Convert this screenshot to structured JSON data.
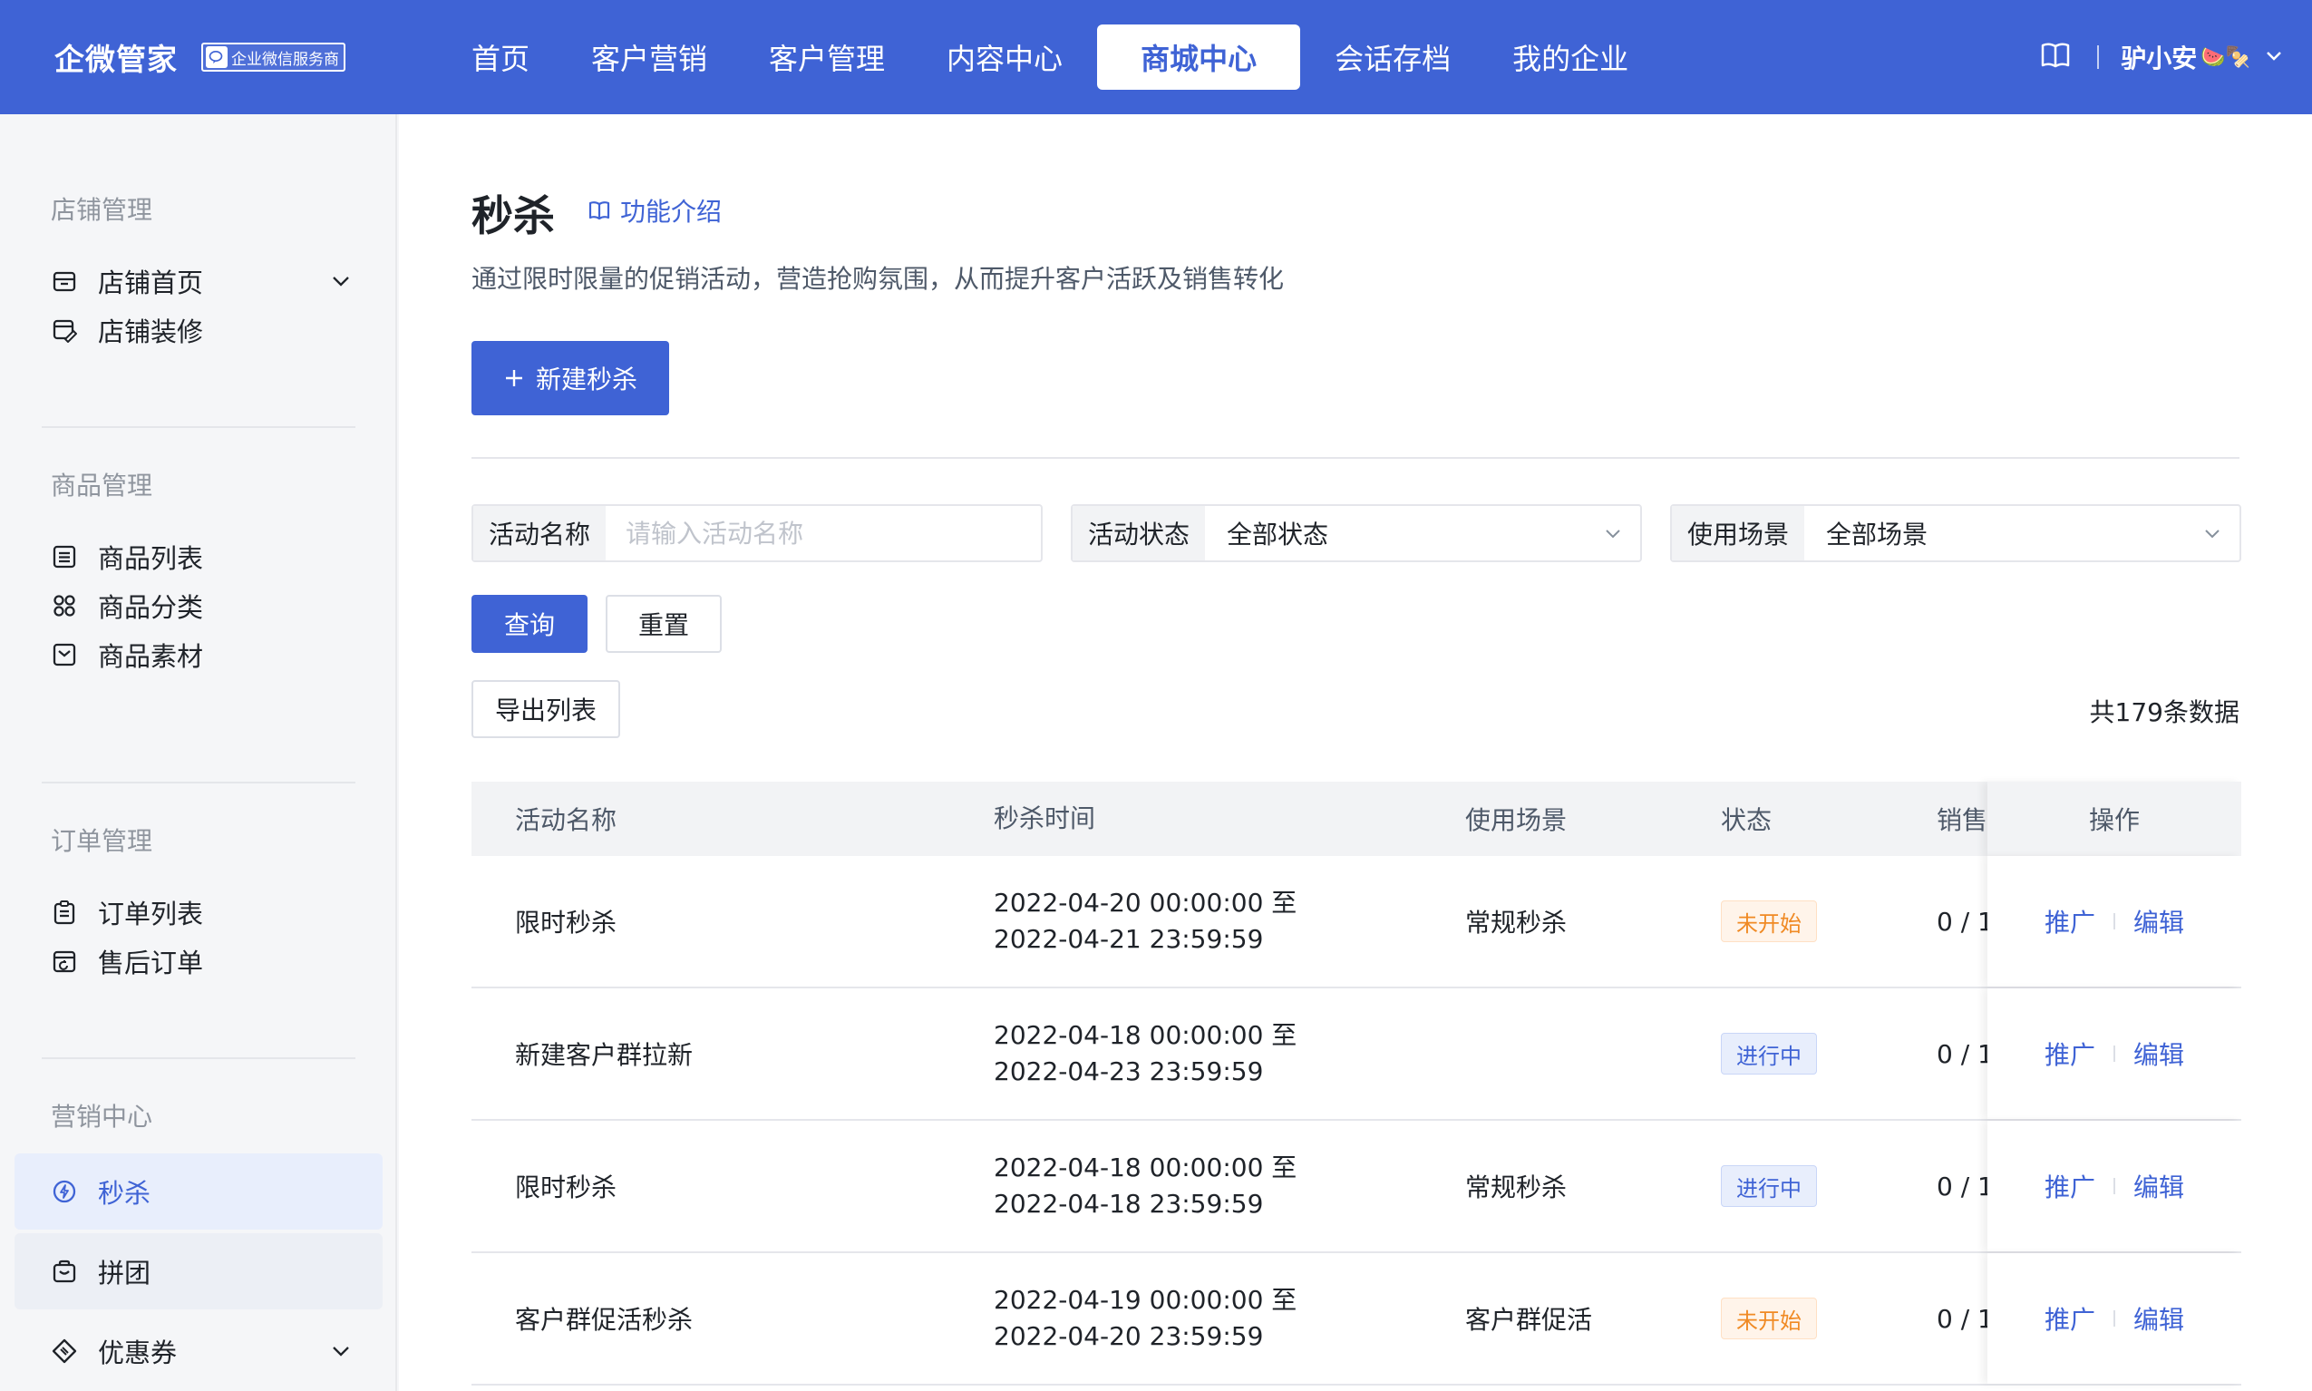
{
  "topbar": {
    "brand": "企微管家",
    "badge": "企业微信服务商",
    "nav": [
      "首页",
      "客户营销",
      "客户管理",
      "内容中心",
      "商城中心",
      "会话存档",
      "我的企业"
    ],
    "active_nav": "商城中心",
    "user_name": "驴小安",
    "user_emoji": "🍉🍢"
  },
  "sidebar": {
    "groups": [
      "店铺管理",
      "商品管理",
      "订单管理",
      "营销中心"
    ],
    "items": [
      {
        "label": "店铺首页",
        "icon": "store-icon"
      },
      {
        "label": "店铺装修",
        "icon": "decorate-icon"
      },
      {
        "label": "商品列表",
        "icon": "list-icon"
      },
      {
        "label": "商品分类",
        "icon": "category-icon"
      },
      {
        "label": "商品素材",
        "icon": "material-icon"
      },
      {
        "label": "订单列表",
        "icon": "order-icon"
      },
      {
        "label": "售后订单",
        "icon": "aftersale-icon"
      },
      {
        "label": "秒杀",
        "icon": "flash-sale-icon"
      },
      {
        "label": "拼团",
        "icon": "group-buy-icon"
      },
      {
        "label": "优惠券",
        "icon": "coupon-icon"
      }
    ]
  },
  "page": {
    "title": "秒杀",
    "intro_link": "功能介绍",
    "description": "通过限时限量的促销活动，营造抢购氛围，从而提升客户活跃及销售转化",
    "new_button": "新建秒杀",
    "query_button": "查询",
    "reset_button": "重置",
    "export_button": "导出列表",
    "count_text": "共179条数据"
  },
  "filters": {
    "name_label": "活动名称",
    "name_placeholder": "请输入活动名称",
    "status_label": "活动状态",
    "status_value": "全部状态",
    "scene_label": "使用场景",
    "scene_value": "全部场景"
  },
  "table": {
    "headers": {
      "name": "活动名称",
      "time": "秒杀时间",
      "scene": "使用场景",
      "status": "状态",
      "sales": "销售",
      "ops": "操作"
    },
    "promote_label": "推广",
    "edit_label": "编辑",
    "rows": [
      {
        "name": "限时秒杀",
        "start": "2022-04-20 00:00:00 至",
        "end": "2022-04-21 23:59:59",
        "scene": "常规秒杀",
        "status": "未开始",
        "status_type": "pending",
        "sales": "0 / 1"
      },
      {
        "name": "新建客户群拉新",
        "start": "2022-04-18 00:00:00 至",
        "end": "2022-04-23 23:59:59",
        "scene": "",
        "status": "进行中",
        "status_type": "running",
        "sales": "0 / 1"
      },
      {
        "name": "限时秒杀",
        "start": "2022-04-18 00:00:00 至",
        "end": "2022-04-18 23:59:59",
        "scene": "常规秒杀",
        "status": "进行中",
        "status_type": "running",
        "sales": "0 / 1"
      },
      {
        "name": "客户群促活秒杀",
        "start": "2022-04-19 00:00:00 至",
        "end": "2022-04-20 23:59:59",
        "scene": "客户群促活",
        "status": "未开始",
        "status_type": "pending",
        "sales": "0 / 1"
      }
    ]
  },
  "colors": {
    "primary": "#3f63d5",
    "pending": "#f08a24",
    "running": "#3f63d5"
  }
}
